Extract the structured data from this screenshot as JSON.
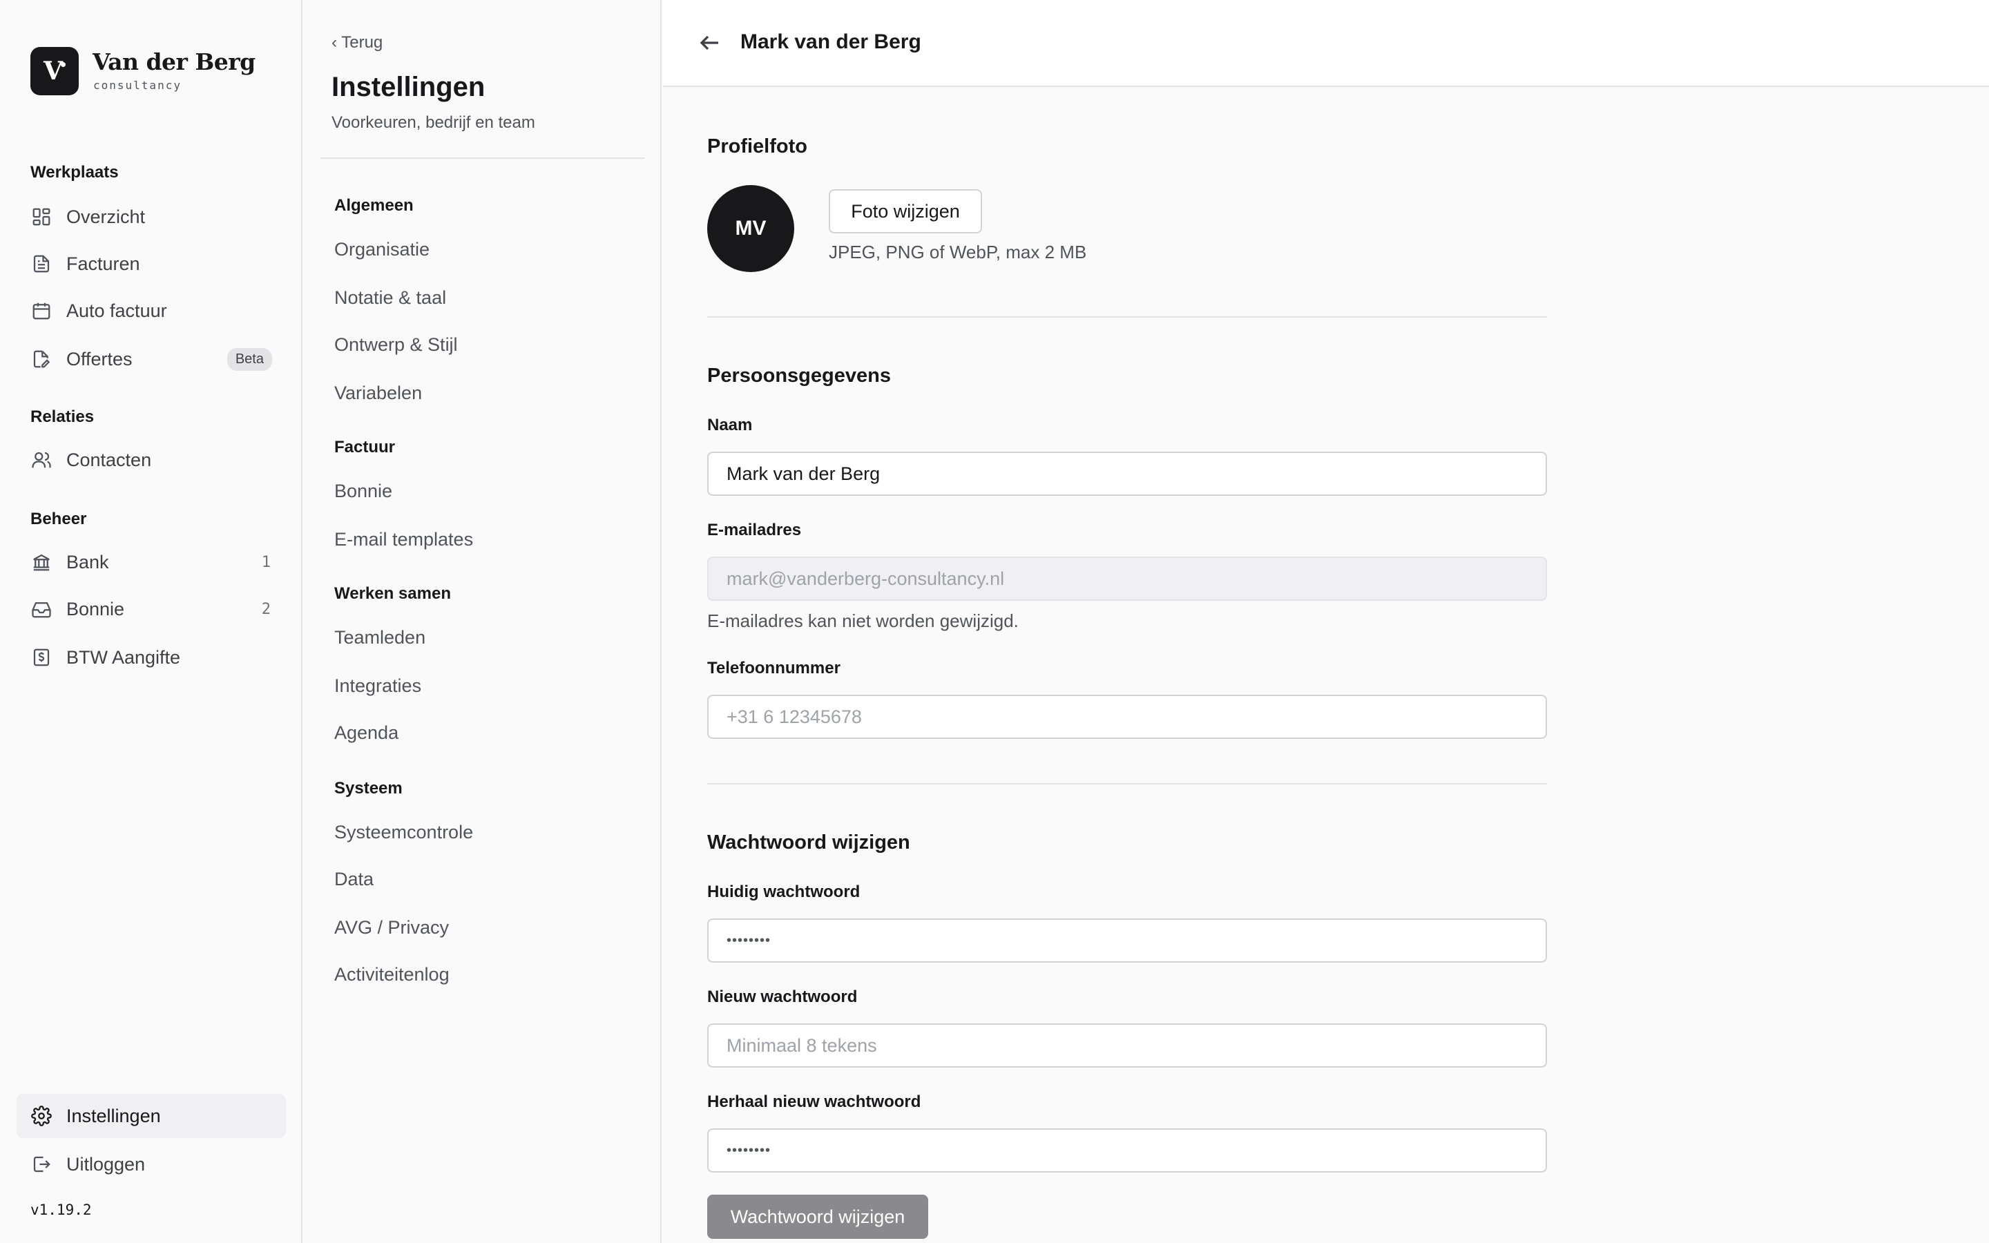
{
  "brand": {
    "name": "Van der Berg",
    "sub": "consultancy",
    "logo_glyph": "V"
  },
  "sidebar": {
    "sections": [
      {
        "heading": "Werkplaats"
      },
      {
        "heading": "Relaties"
      },
      {
        "heading": "Beheer"
      }
    ],
    "items": [
      {
        "label": "Overzicht",
        "icon": "grid-icon"
      },
      {
        "label": "Facturen",
        "icon": "document-icon"
      },
      {
        "label": "Auto factuur",
        "icon": "calendar-icon"
      },
      {
        "label": "Offertes",
        "icon": "document-edit-icon",
        "badge": "Beta"
      },
      {
        "label": "Contacten",
        "icon": "users-icon"
      },
      {
        "label": "Bank",
        "icon": "bank-icon",
        "count": "1"
      },
      {
        "label": "Bonnie",
        "icon": "inbox-icon",
        "count": "2"
      },
      {
        "label": "BTW Aangifte",
        "icon": "receipt-icon"
      }
    ],
    "bottom": [
      {
        "label": "Instellingen",
        "icon": "gear-icon",
        "active": true
      },
      {
        "label": "Uitloggen",
        "icon": "logout-icon"
      }
    ],
    "version": "v1.19.2"
  },
  "subnav": {
    "back": "‹ Terug",
    "title": "Instellingen",
    "subtitle": "Voorkeuren, bedrijf en team",
    "groups": [
      {
        "heading": "Algemeen",
        "items": [
          "Organisatie",
          "Notatie & taal",
          "Ontwerp & Stijl",
          "Variabelen"
        ]
      },
      {
        "heading": "Factuur",
        "items": [
          "Bonnie",
          "E-mail templates"
        ]
      },
      {
        "heading": "Werken samen",
        "items": [
          "Teamleden",
          "Integraties",
          "Agenda"
        ]
      },
      {
        "heading": "Systeem",
        "items": [
          "Systeemcontrole",
          "Data",
          "AVG / Privacy",
          "Activiteitenlog"
        ]
      }
    ]
  },
  "main": {
    "title": "Mark van der Berg",
    "profile_photo": {
      "heading": "Profielfoto",
      "initials": "MV",
      "button": "Foto wijzigen",
      "help": "JPEG, PNG of WebP, max 2 MB"
    },
    "personal": {
      "heading": "Persoonsgegevens",
      "name_label": "Naam",
      "name_value": "Mark van der Berg",
      "email_label": "E-mailadres",
      "email_value": "mark@vanderberg-consultancy.nl",
      "email_help": "E-mailadres kan niet worden gewijzigd.",
      "phone_label": "Telefoonnummer",
      "phone_placeholder": "+31 6 12345678"
    },
    "password": {
      "heading": "Wachtwoord wijzigen",
      "current_label": "Huidig wachtwoord",
      "current_value": "••••••••",
      "new_label": "Nieuw wachtwoord",
      "new_placeholder": "Minimaal 8 tekens",
      "repeat_label": "Herhaal nieuw wachtwoord",
      "repeat_value": "••••••••",
      "submit": "Wachtwoord wijzigen"
    }
  }
}
